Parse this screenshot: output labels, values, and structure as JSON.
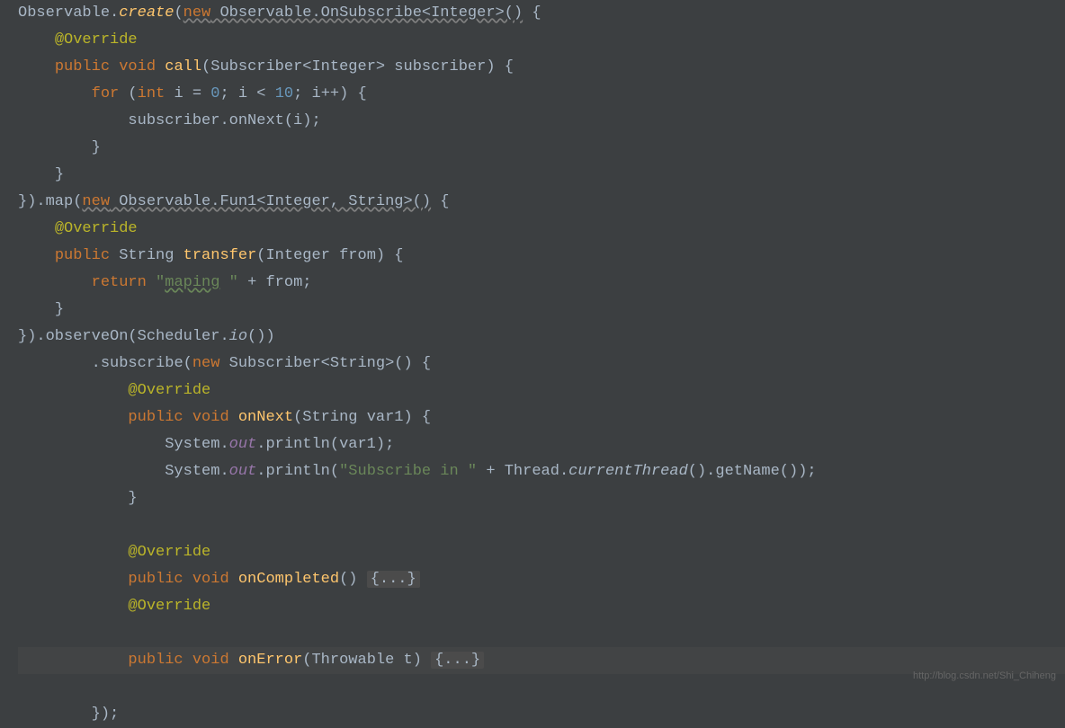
{
  "code": {
    "observable": "Observable",
    "create": "create",
    "new_onsubscribe": "new Observable.OnSubscribe<Integer>()",
    "brace_open": " {",
    "override": "@Override",
    "public": "public",
    "void": "void",
    "call": "call",
    "call_params": "(Subscriber<Integer> subscriber) {",
    "for": "for",
    "int": "int",
    "i_eq": " i = ",
    "zero": "0",
    "semi_lt": "; i < ",
    "ten": "10",
    "semi_inc": "; i++) {",
    "sub_onnext": "subscriber.onNext(i);",
    "brace_close": "}",
    "map": ").map(",
    "new_fun1": "new Observable.Fun1<Integer, String>()",
    "string_type": "String",
    "transfer": "transfer",
    "transfer_params": "(Integer from) {",
    "return": "return",
    "maping_str": "\"maping \"",
    "maping_word": "maping",
    "plus_from": " + from;",
    "observeon": ").observeOn(Scheduler.",
    "io": "io",
    "io_paren": "())",
    "subscribe": ".subscribe(",
    "new": "new",
    "subscriber_str": " Subscriber<String>() {",
    "onnext": "onNext",
    "onnext_params": "(String var1) {",
    "system": "System.",
    "out": "out",
    "println_var1": ".println(var1);",
    "println_open": ".println(",
    "subscribe_in": "\"Subscribe in \"",
    "plus_thread": " + Thread.",
    "currentthread": "currentThread",
    "getname": "().getName());",
    "oncompleted": "onCompleted",
    "oncompleted_params": "() ",
    "folded": "{...}",
    "onerror": "onError",
    "onerror_params": "(Throwable t) ",
    "end": "});"
  },
  "watermark": "http://blog.csdn.net/Shi_Chiheng"
}
